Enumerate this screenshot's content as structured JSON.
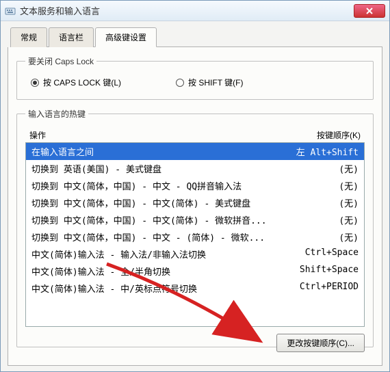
{
  "window_title": "文本服务和输入语言",
  "tabs": {
    "items": [
      {
        "label": "常规"
      },
      {
        "label": "语言栏"
      },
      {
        "label": "高级键设置"
      }
    ],
    "active_index": 2
  },
  "capslock_group": {
    "legend": "要关闭 Caps Lock",
    "option1": "按 CAPS LOCK 键(L)",
    "option2": "按 SHIFT 键(F)",
    "selected": 0
  },
  "hotkey_group": {
    "legend": "输入语言的热键",
    "col_op": "操作",
    "col_key": "按键顺序(K)",
    "rows": [
      {
        "op": "在输入语言之间",
        "key": "左 Alt+Shift",
        "selected": true
      },
      {
        "op": "切换到 英语(美国) - 美式键盘",
        "key": "(无)"
      },
      {
        "op": "切换到 中文(简体，中国) - 中文 - QQ拼音输入法",
        "key": "(无)"
      },
      {
        "op": "切换到 中文(简体，中国) - 中文(简体) - 美式键盘",
        "key": "(无)"
      },
      {
        "op": "切换到 中文(简体，中国) - 中文(简体) - 微软拼音...",
        "key": "(无)"
      },
      {
        "op": "切换到 中文(简体，中国) - 中文 - (简体) - 微软...",
        "key": "(无)"
      },
      {
        "op": "中文(简体)输入法 - 输入法/非输入法切换",
        "key": "Ctrl+Space"
      },
      {
        "op": "中文(简体)输入法 - 全/半角切换",
        "key": "Shift+Space"
      },
      {
        "op": "中文(简体)输入法 - 中/英标点符号切换",
        "key": "Ctrl+PERIOD"
      }
    ],
    "change_button": "更改按键顺序(C)..."
  }
}
